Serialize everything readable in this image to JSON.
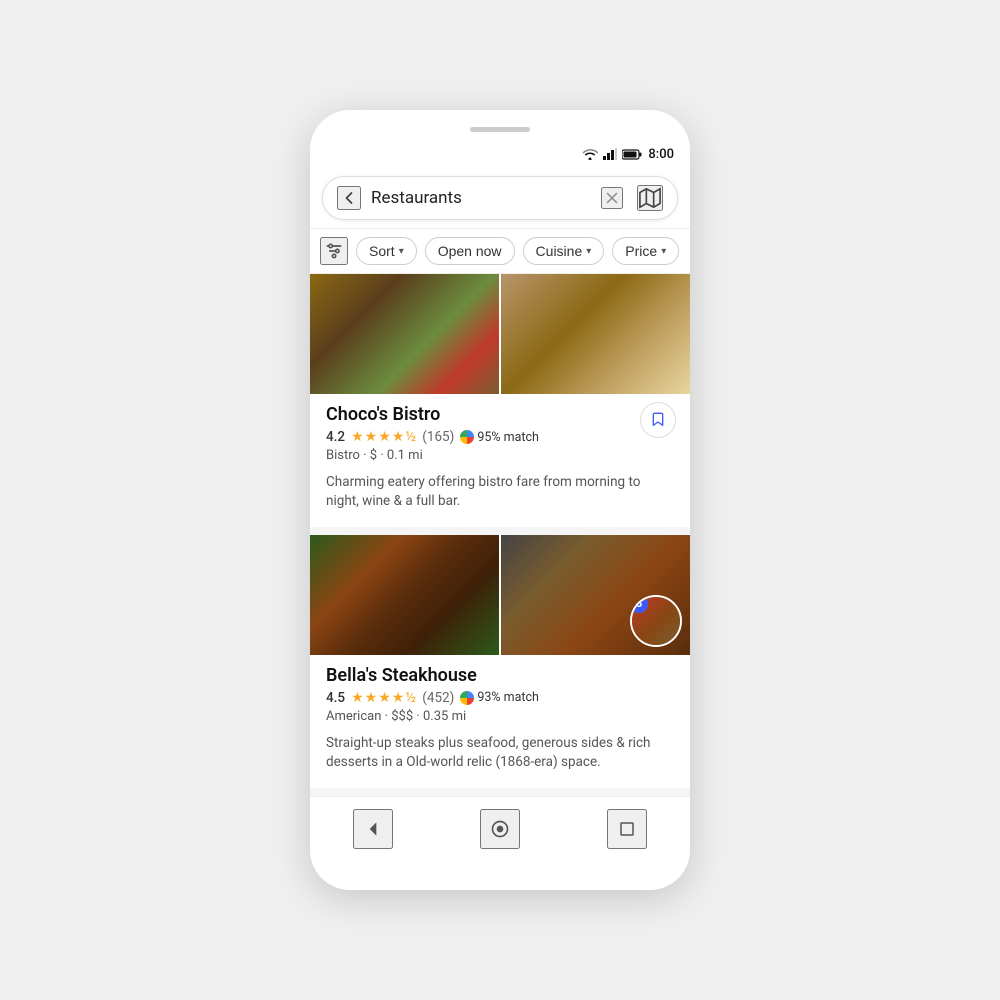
{
  "phone": {
    "time": "8:00"
  },
  "search": {
    "query": "Restaurants",
    "back_label": "back",
    "clear_label": "clear",
    "map_label": "map"
  },
  "filters": {
    "filter_icon_label": "filters",
    "chips": [
      {
        "label": "Sort",
        "has_chevron": true
      },
      {
        "label": "Open now",
        "has_chevron": false
      },
      {
        "label": "Cuisine",
        "has_chevron": true
      },
      {
        "label": "Price",
        "has_chevron": true
      }
    ]
  },
  "restaurants": [
    {
      "name": "Choco's Bistro",
      "rating": "4.2",
      "stars_full": 4,
      "stars_half": true,
      "review_count": "(165)",
      "match_percent": "95% match",
      "details": "Bistro · $ · 0.1 mi",
      "description": "Charming eatery offering bistro fare from morning to night, wine & a full bar.",
      "has_bookmark": true,
      "img1_type": "food-1",
      "img2_type": "food-2"
    },
    {
      "name": "Bella's Steakhouse",
      "rating": "4.5",
      "stars_full": 4,
      "stars_half": true,
      "review_count": "(452)",
      "match_percent": "93% match",
      "details": "American · $$$ · 0.35 mi",
      "description": "Straight-up steaks plus seafood, generous sides & rich desserts in a Old-world relic (1868-era) space.",
      "has_bookmark": false,
      "has_avatar_badge": true,
      "avatar_num": "5",
      "img1_type": "steak-1",
      "img2_type": "steak-2"
    }
  ],
  "nav": {
    "back_label": "back navigation",
    "home_label": "home",
    "recent_label": "recent apps"
  }
}
